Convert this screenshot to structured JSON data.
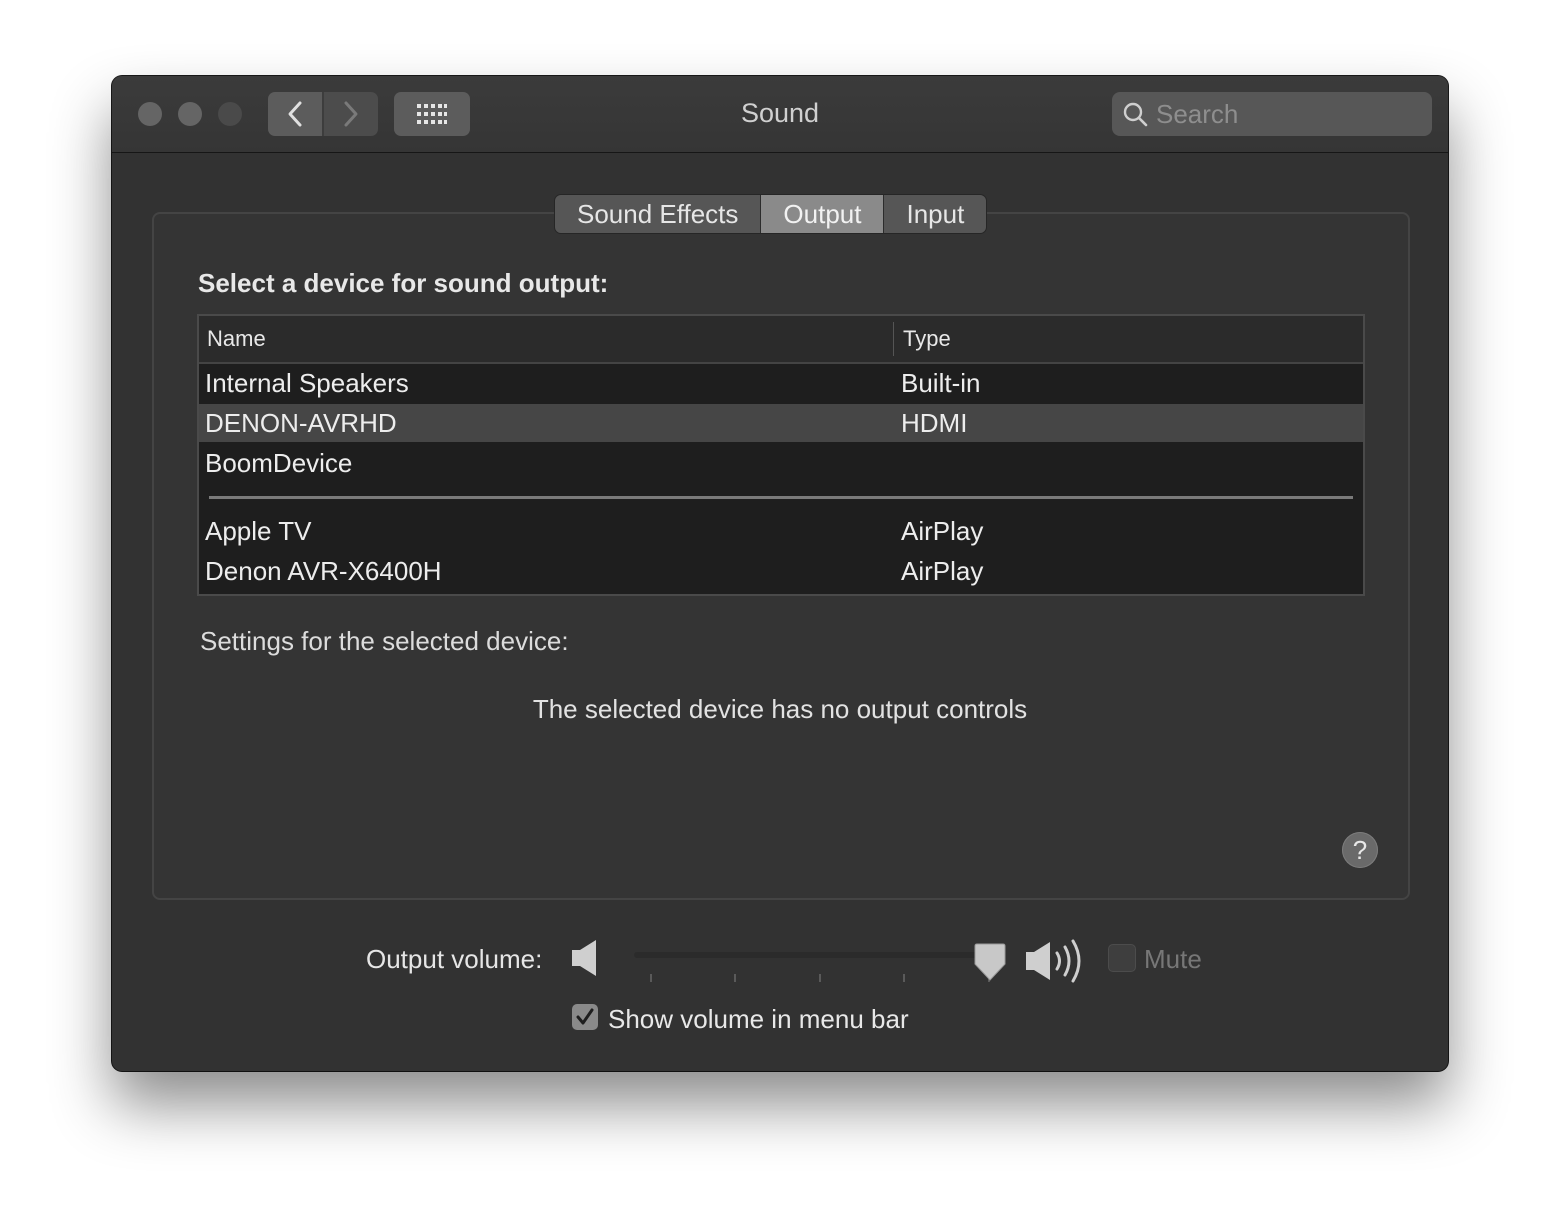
{
  "window": {
    "title": "Sound",
    "search_placeholder": "Search"
  },
  "tabs": [
    {
      "label": "Sound Effects",
      "active": false
    },
    {
      "label": "Output",
      "active": true
    },
    {
      "label": "Input",
      "active": false
    }
  ],
  "output": {
    "heading": "Select a device for sound output:",
    "columns": {
      "name": "Name",
      "type": "Type"
    },
    "devices": [
      {
        "name": "Internal Speakers",
        "type": "Built-in",
        "selected": false
      },
      {
        "name": "DENON-AVRHD",
        "type": "HDMI",
        "selected": true
      },
      {
        "name": "BoomDevice",
        "type": "",
        "selected": false
      },
      {
        "name": "Apple TV",
        "type": "AirPlay",
        "selected": false
      },
      {
        "name": "Denon AVR-X6400H",
        "type": "AirPlay",
        "selected": false
      }
    ],
    "settings_label": "Settings for the selected device:",
    "no_controls_message": "The selected device has no output controls",
    "help_label": "?"
  },
  "volume": {
    "label": "Output volume:",
    "level": 1.0,
    "mute_label": "Mute",
    "muted": false,
    "show_in_menu_bar_label": "Show volume in menu bar",
    "show_in_menu_bar": true
  }
}
